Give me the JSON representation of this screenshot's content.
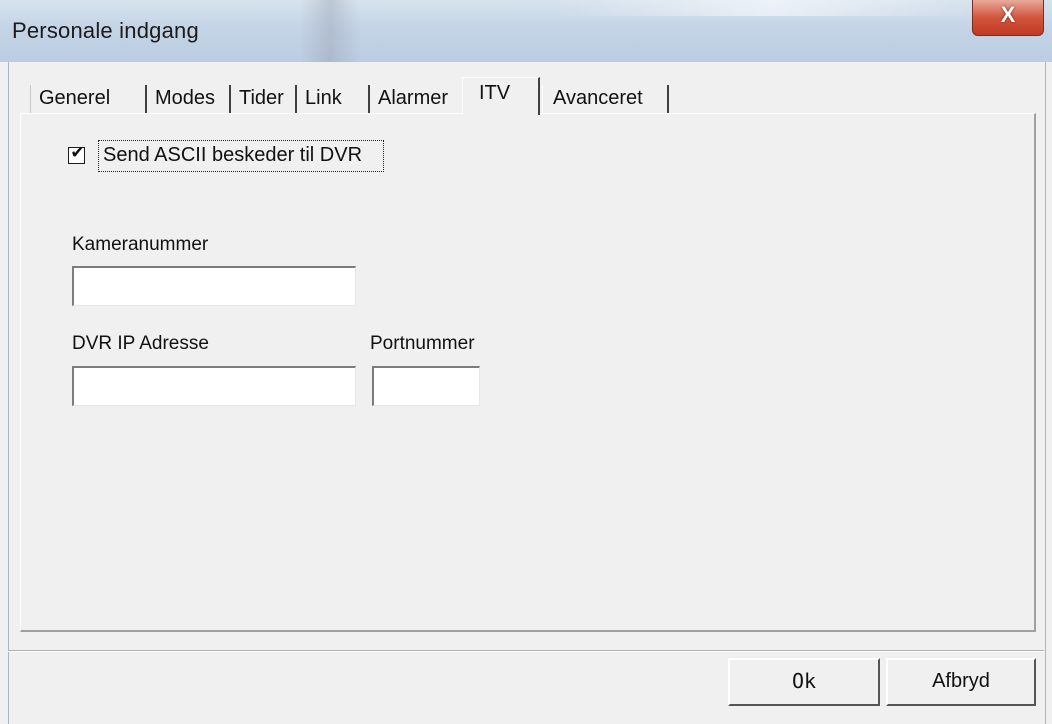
{
  "window": {
    "title": "Personale indgang",
    "close_symbol": "X"
  },
  "tabs": [
    {
      "label": "Generel",
      "active": false
    },
    {
      "label": "Modes",
      "active": false
    },
    {
      "label": "Tider",
      "active": false
    },
    {
      "label": "Link",
      "active": false
    },
    {
      "label": "Alarmer",
      "active": false
    },
    {
      "label": "ITV",
      "active": true
    },
    {
      "label": "Avanceret",
      "active": false
    }
  ],
  "itv": {
    "send_ascii": {
      "label": "Send ASCII beskeder til DVR",
      "checked": true,
      "check_mark": "✔"
    },
    "camera_number": {
      "label": "Kameranummer",
      "value": ""
    },
    "dvr_ip": {
      "label": "DVR IP Adresse",
      "value": ""
    },
    "port": {
      "label": "Portnummer",
      "value": ""
    }
  },
  "buttons": {
    "ok": "Ok",
    "cancel": "Afbryd"
  },
  "colors": {
    "dialog_bg": "#f0f0f0",
    "close_button": "#c94a33",
    "titlebar": "#c4d4e6"
  }
}
